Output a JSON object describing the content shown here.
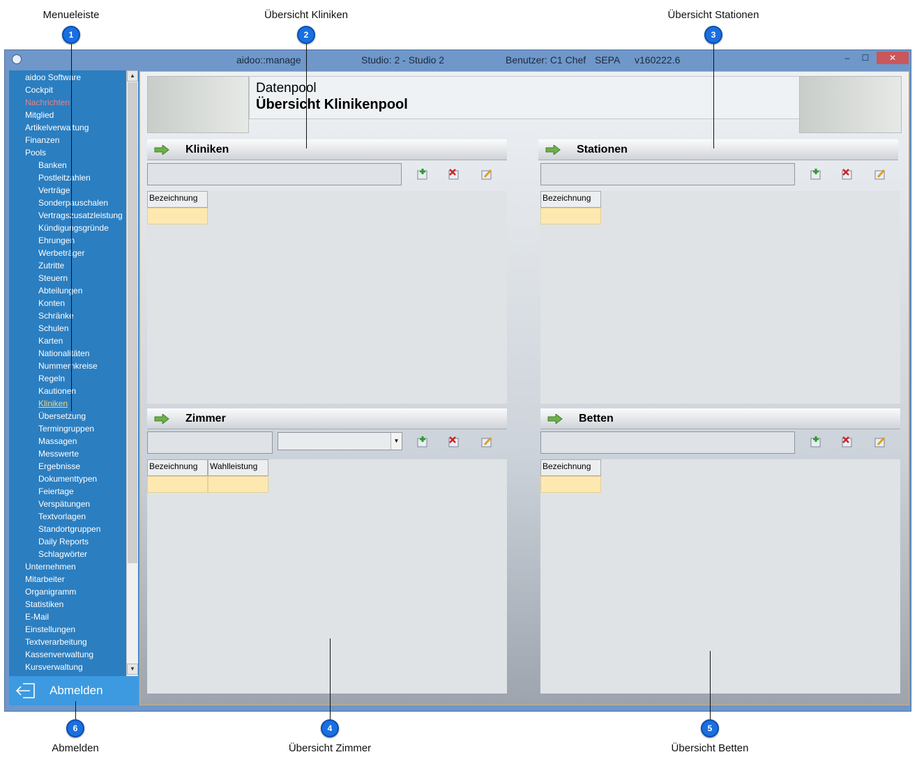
{
  "callouts": [
    {
      "n": "1",
      "label": "Menueleiste"
    },
    {
      "n": "2",
      "label": "Übersicht Kliniken"
    },
    {
      "n": "3",
      "label": "Übersicht Stationen"
    },
    {
      "n": "4",
      "label": "Übersicht Zimmer"
    },
    {
      "n": "5",
      "label": "Übersicht Betten"
    },
    {
      "n": "6",
      "label": "Abmelden"
    }
  ],
  "titlebar": {
    "app": "aidoo::manage",
    "studio": "Studio: 2 - Studio 2",
    "user": "Benutzer: C1 Chef",
    "sepa": "SEPA",
    "version": "v160222.6",
    "minimize": "–",
    "maximize": "☐",
    "close": "✕"
  },
  "sidebar": {
    "items": [
      "aidoo Software",
      "Cockpit",
      "Nachrichten",
      "Mitglied",
      "Artikelverwaltung",
      "Finanzen",
      "Pools",
      "Banken",
      "Postleitzahlen",
      "Verträge",
      "Sonderpauschalen",
      "Vertragszusatzleistung",
      "Kündigungsgründe",
      "Ehrungen",
      "Werbeträger",
      "Zutritte",
      "Steuern",
      "Abteilungen",
      "Konten",
      "Schränke",
      "Schulen",
      "Karten",
      "Nationalitäten",
      "Nummernkreise",
      "Regeln",
      "Kautionen",
      "Kliniken",
      "Übersetzung",
      "Termingruppen",
      "Massagen",
      "Messwerte",
      "Ergebnisse",
      "Dokumenttypen",
      "Feiertage",
      "Verspätungen",
      "Textvorlagen",
      "Standortgruppen",
      "Daily Reports",
      "Schlagwörter",
      "Unternehmen",
      "Mitarbeiter",
      "Organigramm",
      "Statistiken",
      "E-Mail",
      "Einstellungen",
      "Textverarbeitung",
      "Kassenverwaltung",
      "Kursverwaltung"
    ],
    "scroll_up": "▲",
    "scroll_down": "▼",
    "logout_label": "Abmelden"
  },
  "header": {
    "sub": "Datenpool",
    "main": "Übersicht Klinikenpool"
  },
  "sections": {
    "kliniken": {
      "title": "Kliniken",
      "columns": [
        "Bezeichnung"
      ]
    },
    "stationen": {
      "title": "Stationen",
      "columns": [
        "Bezeichnung"
      ]
    },
    "zimmer": {
      "title": "Zimmer",
      "columns": [
        "Bezeichnung",
        "Wahlleistung"
      ],
      "combo_arrow": "▼"
    },
    "betten": {
      "title": "Betten",
      "columns": [
        "Bezeichnung"
      ]
    }
  },
  "colors": {
    "sidebar": "#2b7ec0",
    "alert": "#f08080",
    "active": "#f3d77b",
    "badge": "#1a6fe0"
  }
}
